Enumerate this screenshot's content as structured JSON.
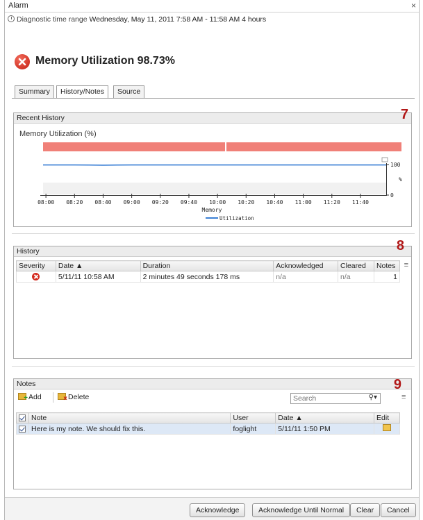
{
  "window": {
    "title": "Alarm",
    "close": "×"
  },
  "range": {
    "label": "Diagnostic time range",
    "value": "Wednesday, May 11, 2011  7:58 AM - 11:58 AM  4 hours"
  },
  "alarm": {
    "title": "Memory Utilization 98.73%",
    "severity_icon": "error-icon"
  },
  "tabs": [
    {
      "label": "Summary",
      "active": false
    },
    {
      "label": "History/Notes",
      "active": true
    },
    {
      "label": "Source",
      "active": false
    }
  ],
  "recent_history": {
    "header": "Recent History",
    "callout": "7",
    "chart_title": "Memory Utilization (%)"
  },
  "chart_data": {
    "type": "line",
    "title": "Memory Utilization (%)",
    "xlabel": "Memory",
    "ylabel": "%",
    "x_ticks": [
      "08:00",
      "08:20",
      "08:40",
      "09:00",
      "09:20",
      "09:40",
      "10:00",
      "10:20",
      "10:40",
      "11:00",
      "11:20",
      "11:40"
    ],
    "y_ticks": [
      "100",
      "0"
    ],
    "ylim": [
      0,
      100
    ],
    "series": [
      {
        "name": "Utilization",
        "color": "#3a7fd5",
        "x": [
          "07:58",
          "08:20",
          "08:30",
          "08:40",
          "08:50",
          "09:00",
          "11:58"
        ],
        "values": [
          98.5,
          98.5,
          98.2,
          97.6,
          98.2,
          98.5,
          98.5
        ]
      }
    ],
    "alarm_band_color": "#f08078",
    "legend_position": "bottom"
  },
  "history": {
    "header": "History",
    "callout": "8",
    "columns": [
      "Severity",
      "Date ▲",
      "Duration",
      "Acknowledged",
      "Cleared",
      "Notes"
    ],
    "rows": [
      {
        "date": "5/11/11 10:58 AM",
        "duration": "2 minutes 49 seconds 178 ms",
        "acknowledged": "n/a",
        "cleared": "n/a",
        "notes": "1"
      }
    ]
  },
  "notes": {
    "header": "Notes",
    "callout": "9",
    "add_label": "Add",
    "delete_label": "Delete",
    "search_placeholder": "Search",
    "columns": [
      "Note",
      "User",
      "Date ▲",
      "Edit"
    ],
    "rows": [
      {
        "note": "Here is my note. We should fix this.",
        "user": "foglight",
        "date": "5/11/11 1:50 PM"
      }
    ]
  },
  "footer": {
    "acknowledge": "Acknowledge",
    "acknowledge_until_normal": "Acknowledge Until Normal",
    "clear": "Clear",
    "cancel": "Cancel"
  }
}
